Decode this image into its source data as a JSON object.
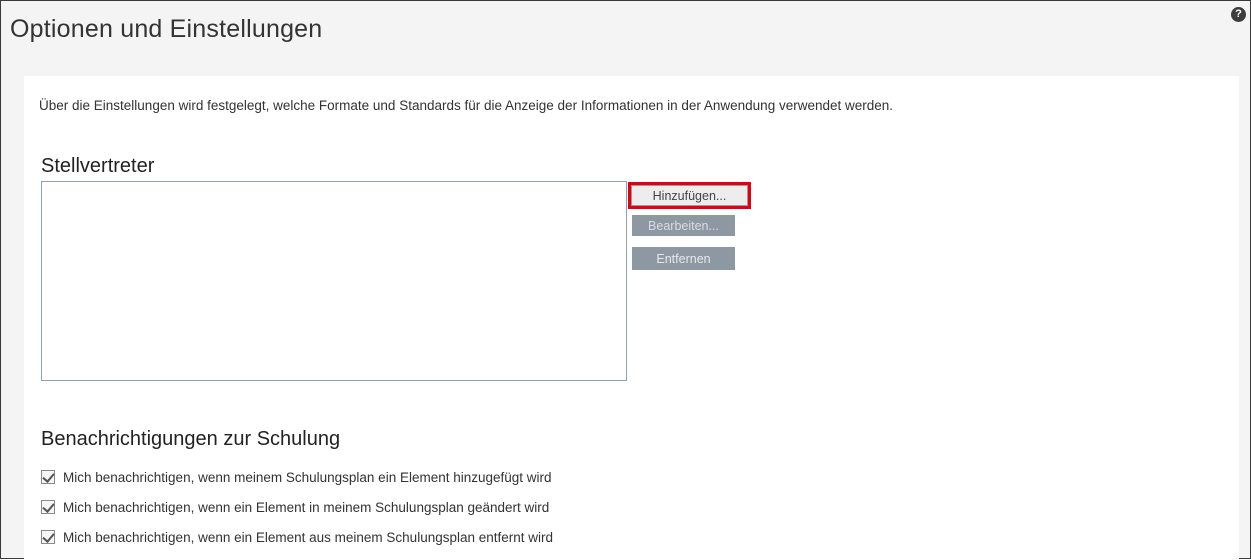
{
  "header": {
    "title": "Optionen und Einstellungen",
    "help_icon": "?"
  },
  "intro_text": "Über die Einstellungen wird festgelegt, welche Formate und Standards für die Anzeige der Informationen in der Anwendung verwendet werden.",
  "deputies": {
    "title": "Stellvertreter",
    "add_label": "Hinzufügen...",
    "edit_label": "Bearbeiten...",
    "remove_label": "Entfernen"
  },
  "notifications": {
    "title": "Benachrichtigungen zur Schulung",
    "options": [
      {
        "label": "Mich benachrichtigen, wenn meinem Schulungsplan ein Element hinzugefügt wird",
        "checked": true
      },
      {
        "label": "Mich benachrichtigen, wenn ein Element in meinem Schulungsplan geändert wird",
        "checked": true
      },
      {
        "label": "Mich benachrichtigen, wenn ein Element aus meinem Schulungsplan entfernt wird",
        "checked": true
      }
    ]
  },
  "colors": {
    "highlight": "#e3000f",
    "disabled_button": "#8e98a3"
  }
}
